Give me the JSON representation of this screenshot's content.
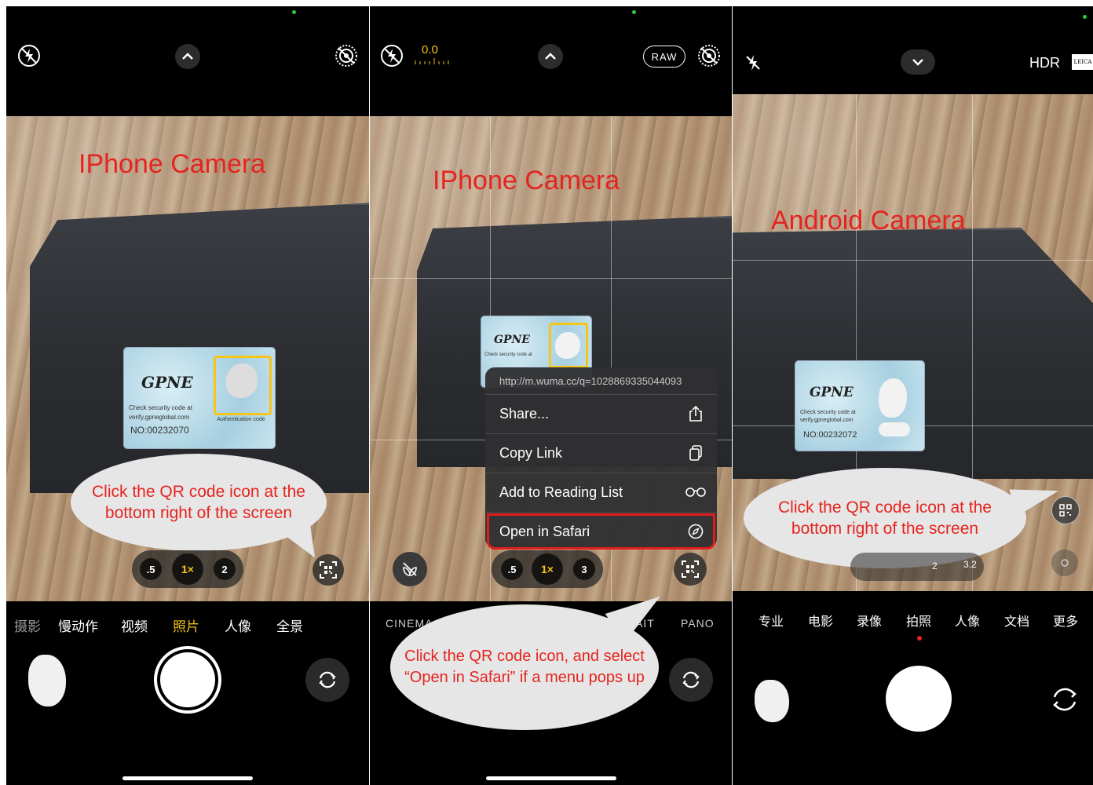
{
  "panel1": {
    "title": "IPhone Camera",
    "bubble": "Click the QR code icon at the bottom right of the screen",
    "zoom": [
      ".5",
      "1×",
      "2"
    ],
    "modes": [
      "摄影",
      "慢动作",
      "视频",
      "照片",
      "人像",
      "全景"
    ],
    "active_mode": "照片",
    "sticker": {
      "brand": "GPNE",
      "line1": "Check security code at",
      "line2": "verify.gpneglobal.com",
      "serial": "NO:00232070",
      "auth": "Authentication code"
    }
  },
  "panel2": {
    "title": "IPhone Camera",
    "exposure": "0.0",
    "raw_label": "RAW",
    "menu": {
      "url": "http://m.wuma.cc/q=1028869335044093",
      "items": [
        "Share...",
        "Copy Link",
        "Add to Reading List",
        "Open in Safari"
      ]
    },
    "zoom": [
      ".5",
      "1×",
      "3"
    ],
    "modes": [
      "CINEMA",
      "AIT",
      "PANO"
    ],
    "bubble": "Click the QR code icon, and select “Open in Safari” if a menu pops up",
    "sticker": {
      "brand": "GPNE",
      "line1": "Check security code at"
    }
  },
  "panel3": {
    "title": "Android Camera",
    "hdr": "HDR",
    "leica": "LEICA",
    "bubble": "Click the QR code icon at the bottom right of the screen",
    "zoom": [
      "2",
      "3.2"
    ],
    "modes": [
      "专业",
      "电影",
      "录像",
      "拍照",
      "人像",
      "文档",
      "更多"
    ],
    "active_mode": "拍照",
    "sticker": {
      "brand": "GPNE",
      "line1": "Check security code at",
      "line2": "verify.gpneglobal.com",
      "serial": "NO:00232072"
    }
  },
  "colors": {
    "annotation_red": "#e5241f",
    "active_yellow": "#f5c518",
    "highlight_red": "#e01c1c"
  }
}
